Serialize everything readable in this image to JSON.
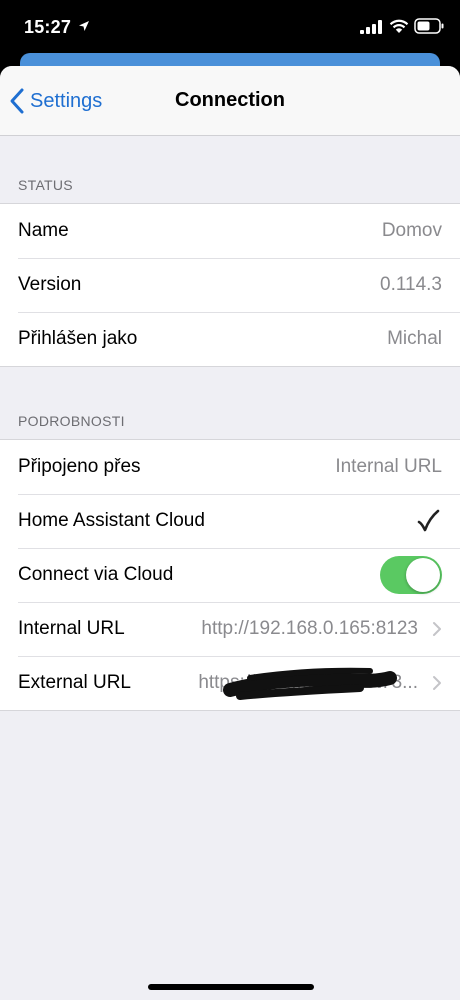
{
  "status_bar": {
    "time": "15:27"
  },
  "nav": {
    "back_label": "Settings",
    "title": "Connection"
  },
  "sections": {
    "status": {
      "header": "STATUS",
      "rows": [
        {
          "label": "Name",
          "value": "Domov"
        },
        {
          "label": "Version",
          "value": "0.114.3"
        },
        {
          "label": "Přihlášen jako",
          "value": "Michal"
        }
      ]
    },
    "details": {
      "header": "PODROBNOSTI",
      "connected_via": {
        "label": "Připojeno přes",
        "value": "Internal URL"
      },
      "ha_cloud": {
        "label": "Home Assistant Cloud",
        "checked": true
      },
      "connect_via_cloud": {
        "label": "Connect via Cloud",
        "enabled": true
      },
      "internal_url": {
        "label": "Internal URL",
        "value": "http://192.168.0.165:8123"
      },
      "external_url": {
        "label": "External URL",
        "value": "https://7pc...........a6ot73..."
      }
    }
  },
  "colors": {
    "accent": "#1f6fd1",
    "toggle_on": "#5ac962",
    "sheet_bg": "#efeff4"
  }
}
